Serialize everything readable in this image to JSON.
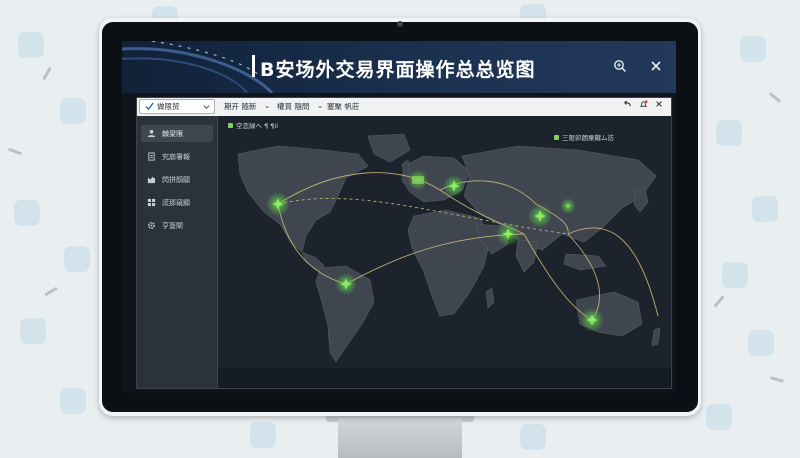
{
  "window": {
    "title": "B安场外交易界面操作总总览图",
    "icons": {
      "title_dropdown": "chevron-down-icon",
      "zoom": "zoom-icon",
      "close": "close-icon"
    }
  },
  "app": {
    "selector": {
      "label": "做限贸",
      "icon": "check-icon"
    },
    "menu": [
      {
        "label": "期开 随新"
      },
      {
        "label": "權買 隨問"
      },
      {
        "label": "塞聚 帆莊"
      }
    ],
    "controls": {
      "back": "back-icon",
      "notifications": "bell-icon",
      "close": "close-icon"
    }
  },
  "sidebar": {
    "items": [
      {
        "label": "棘梁限",
        "icon": "user-icon"
      },
      {
        "label": "究崩署報",
        "icon": "document-icon"
      },
      {
        "label": "閃拼顏願",
        "icon": "chart-icon"
      },
      {
        "label": "謊那窺顯",
        "icon": "grid-icon"
      },
      {
        "label": "亨簽閘",
        "icon": "gear-icon"
      }
    ]
  },
  "map": {
    "label_left": "空恋緑へ ¶ ¶ii",
    "label_right": "三限卯朗粟鞬ム彷",
    "accent": "#5fd14a",
    "route_color": "#d8c27a",
    "hubs": [
      "north-america",
      "south-america",
      "western-europe",
      "eastern-europe",
      "middle-east",
      "south-asia",
      "east-asia",
      "australia"
    ]
  }
}
